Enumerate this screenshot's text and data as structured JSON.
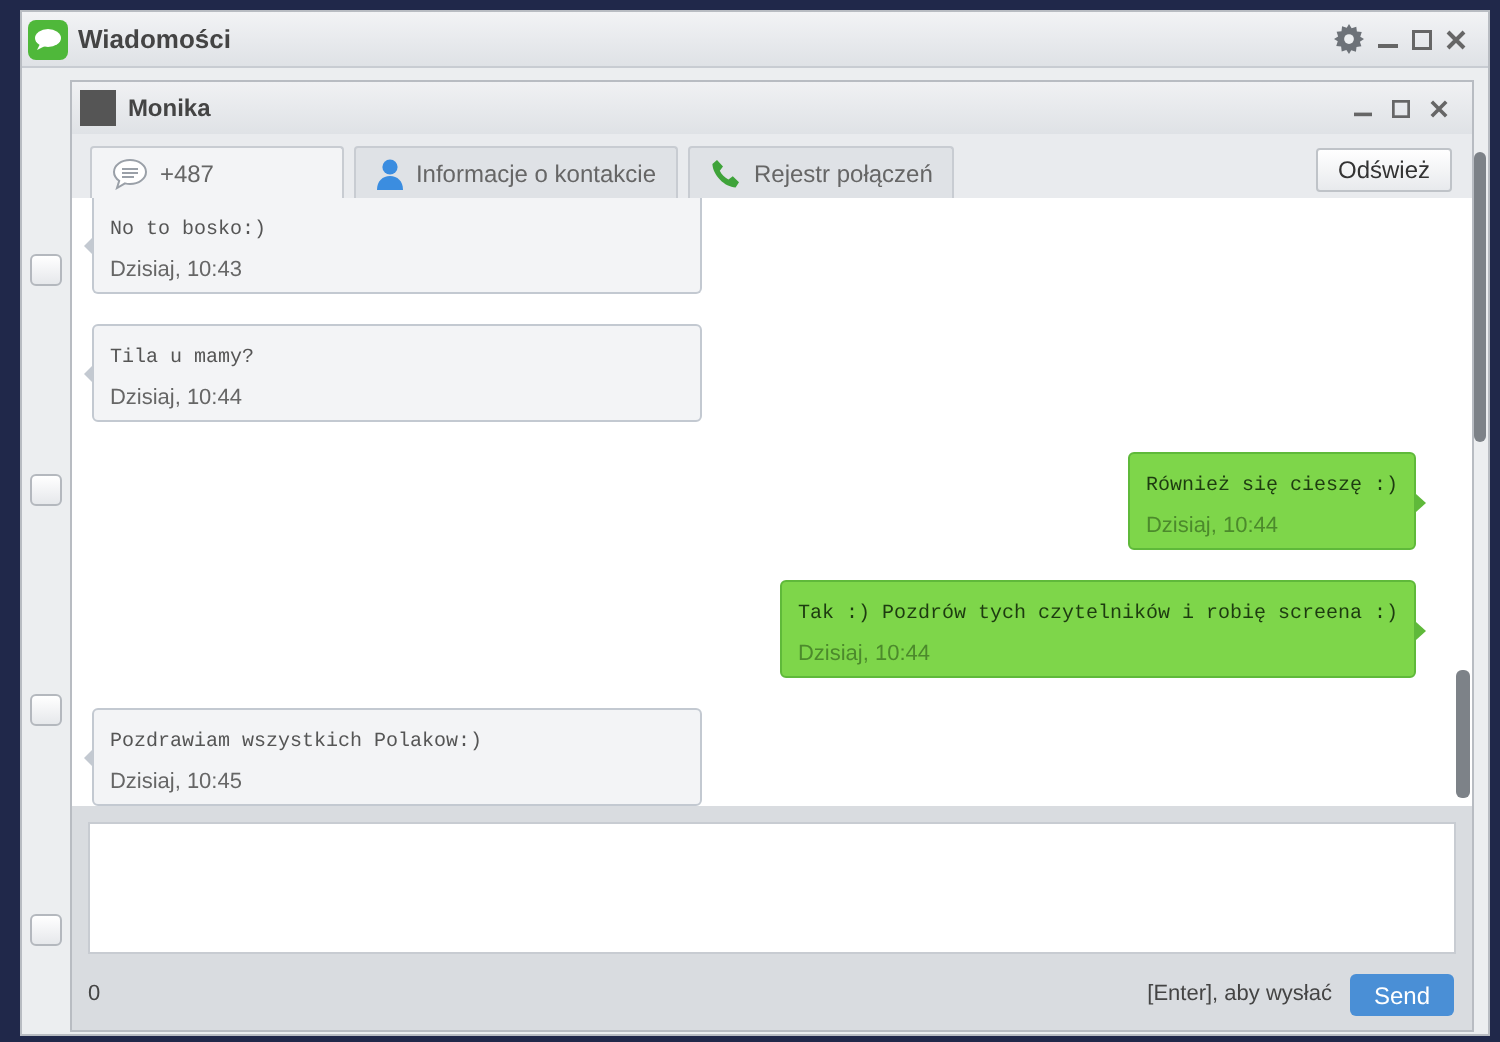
{
  "window": {
    "title": "Wiadomości"
  },
  "conversation": {
    "contact": "Monika",
    "tabs": [
      {
        "label": "+487",
        "kind": "messages",
        "selected": true
      },
      {
        "label": "Informacje o kontakcie",
        "kind": "contact",
        "selected": false
      },
      {
        "label": "Rejestr połączeń",
        "kind": "calls",
        "selected": false
      }
    ],
    "refresh_button": "Odśwież",
    "messages": [
      {
        "kind": "incoming",
        "text": "No to bosko:)",
        "time": "Dzisiaj, 10:43"
      },
      {
        "kind": "incoming",
        "text": "Tila u mamy?",
        "time": "Dzisiaj, 10:44"
      },
      {
        "kind": "outgoing",
        "text": "Również się cieszę :)",
        "time": "Dzisiaj, 10:44"
      },
      {
        "kind": "outgoing",
        "text": "Tak :) Pozdrów tych czytelników i robię screena :)",
        "time": "Dzisiaj, 10:44"
      },
      {
        "kind": "incoming",
        "text": "Pozdrawiam wszystkich Polakow:)",
        "time": "Dzisiaj, 10:45"
      }
    ],
    "char_count": "0",
    "send_hint": "[Enter], aby wysłać",
    "send_button": "Send"
  },
  "checkboxes": [
    {
      "checked": false
    },
    {
      "checked": false
    },
    {
      "checked": false
    },
    {
      "checked": false
    }
  ]
}
